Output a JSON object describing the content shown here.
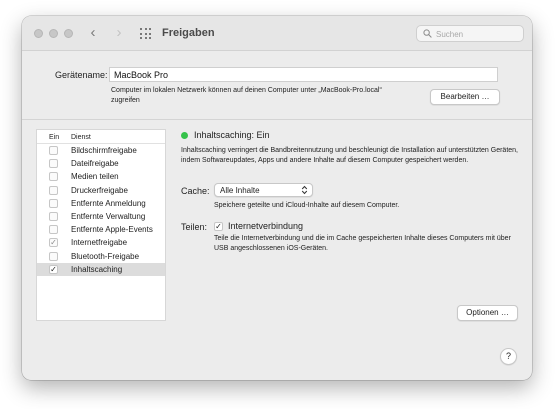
{
  "window": {
    "title": "Freigaben",
    "search_placeholder": "Suchen"
  },
  "computer_name": {
    "label": "Gerätename:",
    "value": "MacBook Pro",
    "description": "Computer im lokalen Netzwerk können auf deinen Computer unter „MacBook-Pro.local“ zugreifen",
    "edit_button": "Bearbeiten …"
  },
  "services": {
    "header_on": "Ein",
    "header_service": "Dienst",
    "items": [
      {
        "label": "Bildschirmfreigabe",
        "checked": false,
        "selected": false
      },
      {
        "label": "Dateifreigabe",
        "checked": false,
        "selected": false
      },
      {
        "label": "Medien teilen",
        "checked": false,
        "selected": false
      },
      {
        "label": "Druckerfreigabe",
        "checked": false,
        "selected": false
      },
      {
        "label": "Entfernte Anmeldung",
        "checked": false,
        "selected": false
      },
      {
        "label": "Entfernte Verwaltung",
        "checked": false,
        "selected": false
      },
      {
        "label": "Entfernte Apple-Events",
        "checked": false,
        "selected": false
      },
      {
        "label": "Internetfreigabe",
        "checked": true,
        "dimmed": true,
        "selected": false
      },
      {
        "label": "Bluetooth-Freigabe",
        "checked": false,
        "selected": false
      },
      {
        "label": "Inhaltscaching",
        "checked": true,
        "selected": true
      }
    ]
  },
  "detail": {
    "status": "Inhaltscaching: Ein",
    "status_color": "#35c24a",
    "description": "Inhaltscaching verringert die Bandbreitennutzung und beschleunigt die Installation auf unterstützten Geräten, indem Softwareupdates, Apps und andere Inhalte auf diesem Computer gespeichert werden.",
    "cache_label": "Cache:",
    "cache_value": "Alle Inhalte",
    "cache_description": "Speichere geteilte und iCloud-Inhalte auf diesem Computer.",
    "share_label": "Teilen:",
    "share_checkbox_label": "Internetverbindung",
    "share_checked": true,
    "share_description": "Teile die Internetverbindung und die im Cache gespeicherten Inhalte dieses Computers mit über USB angeschlossenen iOS-Geräten.",
    "options_button": "Optionen …"
  },
  "help_label": "?",
  "icons": {
    "back": "chevron-left-icon",
    "forward": "chevron-right-icon",
    "show_all": "grid-icon",
    "search": "search-icon"
  }
}
